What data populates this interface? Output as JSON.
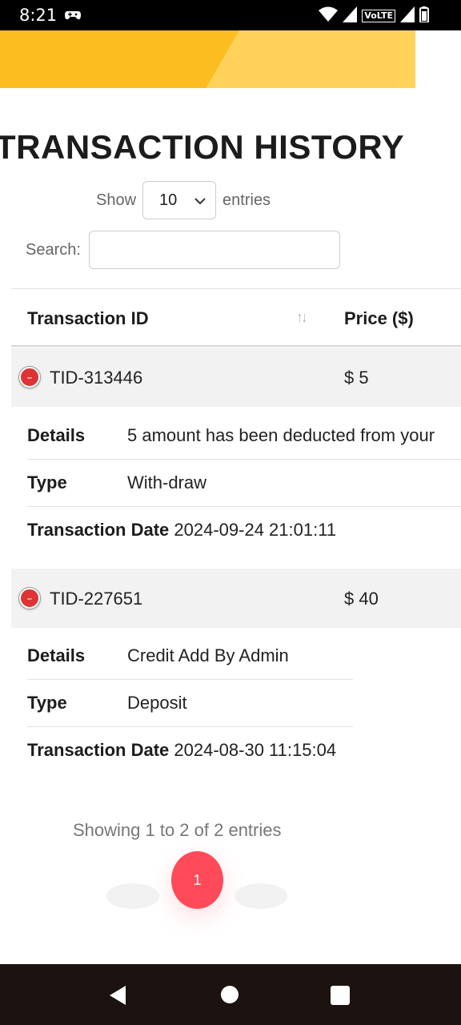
{
  "status_bar": {
    "time": "8:21",
    "volte_label": "VoLTE"
  },
  "page": {
    "title": "TRANSACTION HISTORY"
  },
  "length_control": {
    "show_label": "Show",
    "selected_value": "10",
    "entries_label": "entries"
  },
  "search": {
    "label": "Search:",
    "value": ""
  },
  "table": {
    "headers": [
      "Transaction ID",
      "Price ($)"
    ],
    "rows": [
      {
        "id": "TID-313446",
        "price": "$ 5",
        "details_label": "Details",
        "details": "5 amount has been deducted from your",
        "type_label": "Type",
        "type": "With-draw",
        "date_label": "Transaction Date",
        "date": "2024-09-24 21:01:11"
      },
      {
        "id": "TID-227651",
        "price": "$ 40",
        "details_label": "Details",
        "details": "Credit Add By Admin",
        "type_label": "Type",
        "type": "Deposit",
        "date_label": "Transaction Date",
        "date": "2024-08-30 11:15:04"
      }
    ]
  },
  "pagination": {
    "info": "Showing 1 to 2 of 2 entries",
    "current_page": "1"
  },
  "colors": {
    "banner": "#fbbd1f",
    "accent": "#ff4a5a",
    "collapse_button": "#dd3333"
  },
  "icons": {
    "status_game": "gamepad-icon",
    "status_wifi": "wifi-icon",
    "status_signal": "signal-icon",
    "status_battery": "battery-icon",
    "select_caret": "chevron-down-icon",
    "sort": "sort-arrows-icon",
    "row_toggle": "minus-circle-icon",
    "nav_back": "back-triangle-icon",
    "nav_home": "home-circle-icon",
    "nav_recent": "recent-square-icon"
  }
}
